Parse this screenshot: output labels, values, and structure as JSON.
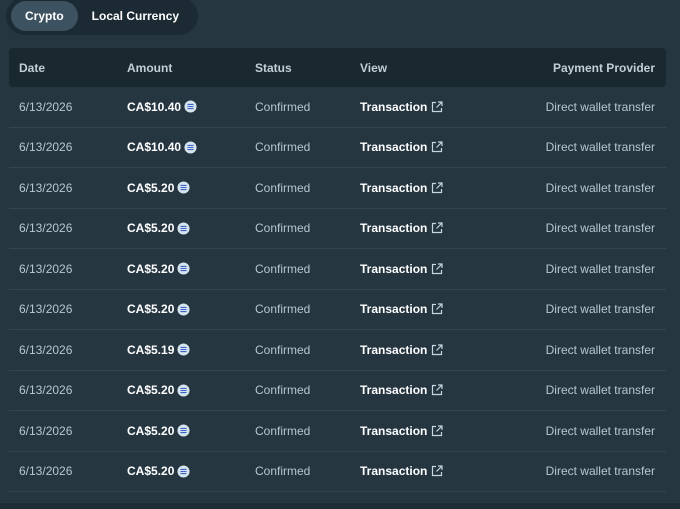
{
  "tabs": [
    {
      "label": "Crypto",
      "active": true
    },
    {
      "label": "Local Currency",
      "active": false
    }
  ],
  "columns": {
    "date": "Date",
    "amount": "Amount",
    "status": "Status",
    "view": "View",
    "provider": "Payment Provider"
  },
  "rows": [
    {
      "date": "6/13/2026",
      "amount": "CA$10.40",
      "status": "Confirmed",
      "view": "Transaction",
      "provider": "Direct wallet transfer"
    },
    {
      "date": "6/13/2026",
      "amount": "CA$10.40",
      "status": "Confirmed",
      "view": "Transaction",
      "provider": "Direct wallet transfer"
    },
    {
      "date": "6/13/2026",
      "amount": "CA$5.20",
      "status": "Confirmed",
      "view": "Transaction",
      "provider": "Direct wallet transfer"
    },
    {
      "date": "6/13/2026",
      "amount": "CA$5.20",
      "status": "Confirmed",
      "view": "Transaction",
      "provider": "Direct wallet transfer"
    },
    {
      "date": "6/13/2026",
      "amount": "CA$5.20",
      "status": "Confirmed",
      "view": "Transaction",
      "provider": "Direct wallet transfer"
    },
    {
      "date": "6/13/2026",
      "amount": "CA$5.20",
      "status": "Confirmed",
      "view": "Transaction",
      "provider": "Direct wallet transfer"
    },
    {
      "date": "6/13/2026",
      "amount": "CA$5.19",
      "status": "Confirmed",
      "view": "Transaction",
      "provider": "Direct wallet transfer"
    },
    {
      "date": "6/13/2026",
      "amount": "CA$5.20",
      "status": "Confirmed",
      "view": "Transaction",
      "provider": "Direct wallet transfer"
    },
    {
      "date": "6/13/2026",
      "amount": "CA$5.20",
      "status": "Confirmed",
      "view": "Transaction",
      "provider": "Direct wallet transfer"
    },
    {
      "date": "6/13/2026",
      "amount": "CA$5.20",
      "status": "Confirmed",
      "view": "Transaction",
      "provider": "Direct wallet transfer"
    }
  ],
  "icons": {
    "coin": "crypto-coin-icon",
    "external": "external-link-icon"
  },
  "colors": {
    "background": "#253641",
    "header_bg": "#1a2830",
    "active_tab": "#3d5261",
    "coin_icon": "#cfe0ea"
  }
}
